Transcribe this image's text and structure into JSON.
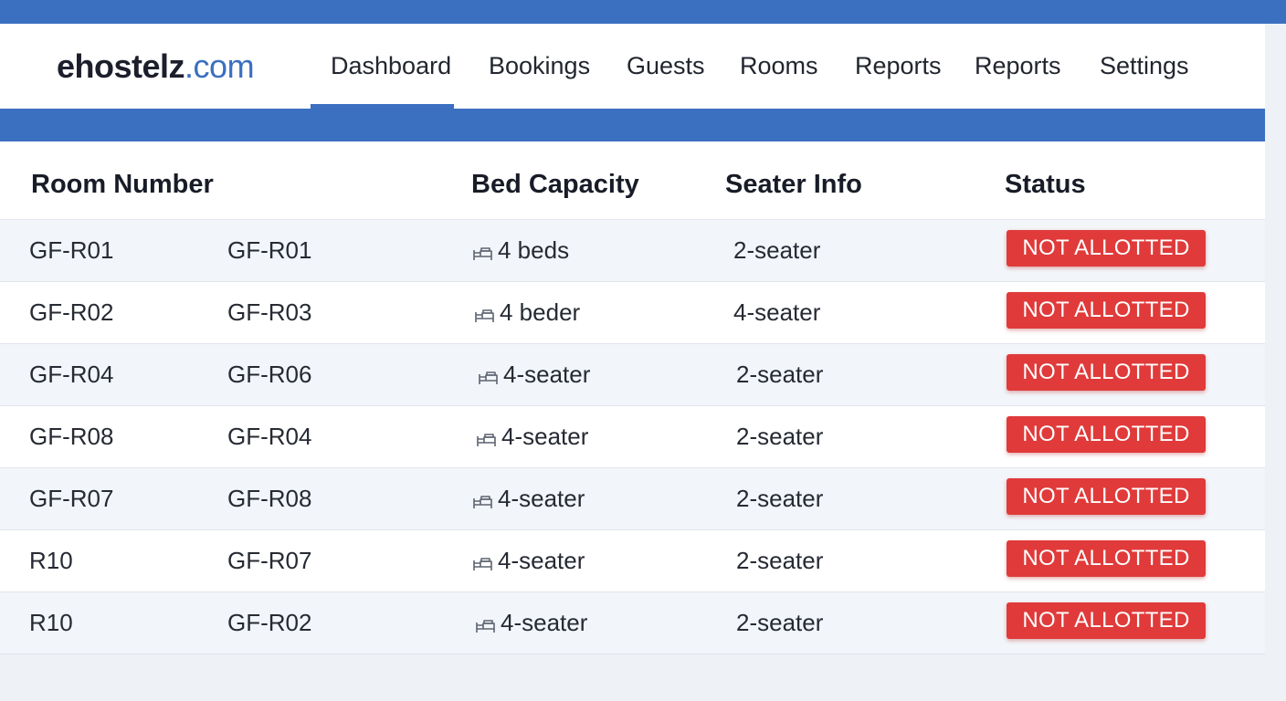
{
  "app": {
    "logo_main": "ehostelz",
    "logo_accent": ".com"
  },
  "nav": {
    "items": [
      {
        "label": "Dashboard",
        "active": true
      },
      {
        "label": "Bookings"
      },
      {
        "label": "Guests"
      },
      {
        "label": "Rooms"
      },
      {
        "label": "Reports"
      },
      {
        "label": "Reports"
      },
      {
        "label": "Settings"
      }
    ]
  },
  "table": {
    "headers": {
      "room_number": "Room Number",
      "bed_capacity": "Bed Capacity",
      "seater_info": "Seater Info",
      "status": "Status"
    },
    "rows": [
      {
        "room_a": "GF-R01",
        "room_b": "GF-R01",
        "beds": "4 beds",
        "seater": "2-seater",
        "status": "NOT ALLOTTED"
      },
      {
        "room_a": "GF-R02",
        "room_b": "GF-R03",
        "beds": "4 beder",
        "seater": "4-seater",
        "status": "NOT ALLOTTED"
      },
      {
        "room_a": "GF-R04",
        "room_b": "GF-R06",
        "beds": "4-seater",
        "seater": "2-seater",
        "status": "NOT ALLOTTED"
      },
      {
        "room_a": "GF-R08",
        "room_b": "GF-R04",
        "beds": "4-seater",
        "seater": "2-seater",
        "status": "NOT ALLOTTED"
      },
      {
        "room_a": "GF-R07",
        "room_b": "GF-R08",
        "beds": "4-seater",
        "seater": "2-seater",
        "status": "NOT ALLOTTED"
      },
      {
        "room_a": "R10",
        "room_b": "GF-R07",
        "beds": "4-seater",
        "seater": "2-seater",
        "status": "NOT ALLOTTED"
      },
      {
        "room_a": "R10",
        "room_b": "GF-R02",
        "beds": "4-seater",
        "seater": "2-seater",
        "status": "NOT ALLOTTED"
      }
    ],
    "bed_icon": "bed-icon"
  },
  "colors": {
    "brand": "#3b6fc0",
    "status_not_allotted": "#e03a3a"
  }
}
